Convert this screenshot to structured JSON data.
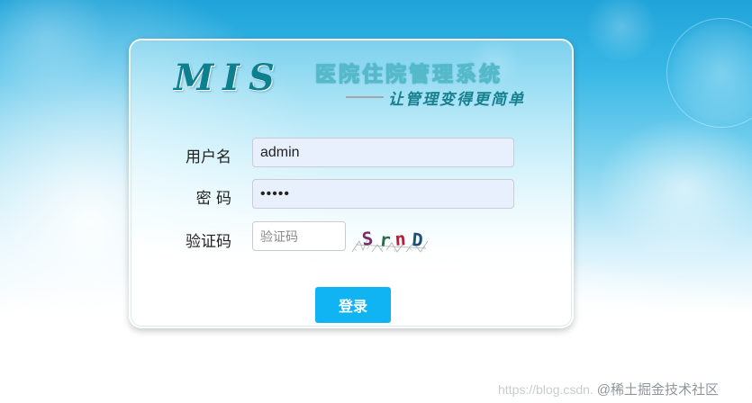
{
  "brand": {
    "logo_text": "MIS",
    "system_title": "医院住院管理系统",
    "slogan": "让管理变得更简单"
  },
  "form": {
    "username_label": "用户名",
    "username_value": "admin",
    "password_label": "密 码",
    "password_masked": "•••••",
    "captcha_label": "验证码",
    "captcha_placeholder": "验证码",
    "captcha_code": "SrnD",
    "captcha_colors": [
      "#7a2b6a",
      "#2d6b4a",
      "#b0243a",
      "#1e4f7a"
    ]
  },
  "actions": {
    "login_label": "登录",
    "button_color": "#10b4f3"
  },
  "watermark": {
    "url_text": "https://blog.csdn.",
    "community_text": "@稀土掘金技术社区"
  }
}
